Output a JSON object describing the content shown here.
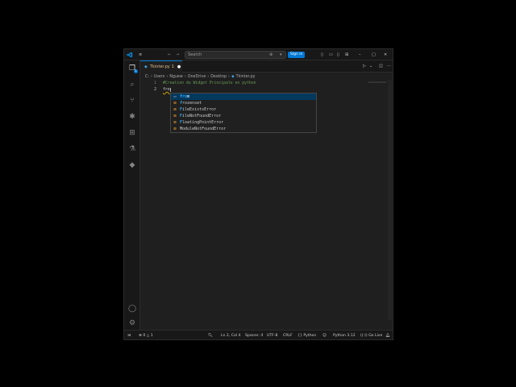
{
  "titlebar": {
    "menu_icon": "hamburger-icon",
    "search_placeholder": "Search",
    "sign_in": "Sign in"
  },
  "activity_bar": {
    "items": [
      "explorer-icon",
      "search-icon",
      "source-control-icon",
      "debug-icon",
      "extensions-icon",
      "testing-icon",
      "python-icon"
    ],
    "explorer_badge": "1",
    "bottom": [
      "account-icon",
      "gear-icon"
    ]
  },
  "tab": {
    "label": "Tkinter.py",
    "badge": "1",
    "modified": "●"
  },
  "breadcrumb": [
    "C:",
    "Users",
    "Nguew",
    "OneDrive",
    "Desktop",
    "Tkinter.py"
  ],
  "editor": {
    "line_numbers": [
      "1",
      "2"
    ],
    "line1": "#Creation du Widget Principale en python",
    "line2": "fro"
  },
  "suggestions": [
    {
      "match": "fro",
      "rest": "m",
      "kind": "keyword",
      "selected": true
    },
    {
      "match": "f",
      "pre": "",
      "rest": "rozenset",
      "kind": "class",
      "selected": false
    },
    {
      "match": "F",
      "rest": "ileExistsError",
      "kind": "class",
      "selected": false
    },
    {
      "match": "F",
      "rest": "ileNotFoundError",
      "kind": "class",
      "selected": false
    },
    {
      "match": "F",
      "rest": "loatingPointError",
      "kind": "class",
      "selected": false
    },
    {
      "match": "",
      "rest": "ModuleNotFoundError",
      "kind": "class",
      "selected": false
    }
  ],
  "statusbar": {
    "errors": "0",
    "warnings": "1",
    "position": "Ln 2, Col 4",
    "spaces": "Spaces: 4",
    "encoding": "UTF-8",
    "eol": "CRLF",
    "language": "Python",
    "interpreter": "Python 3.12",
    "golive": "Go Live"
  },
  "colors": {
    "accent": "#0078d4",
    "editor_bg": "#1f1f1f",
    "comment": "#6a9955",
    "selection": "#04395e"
  }
}
